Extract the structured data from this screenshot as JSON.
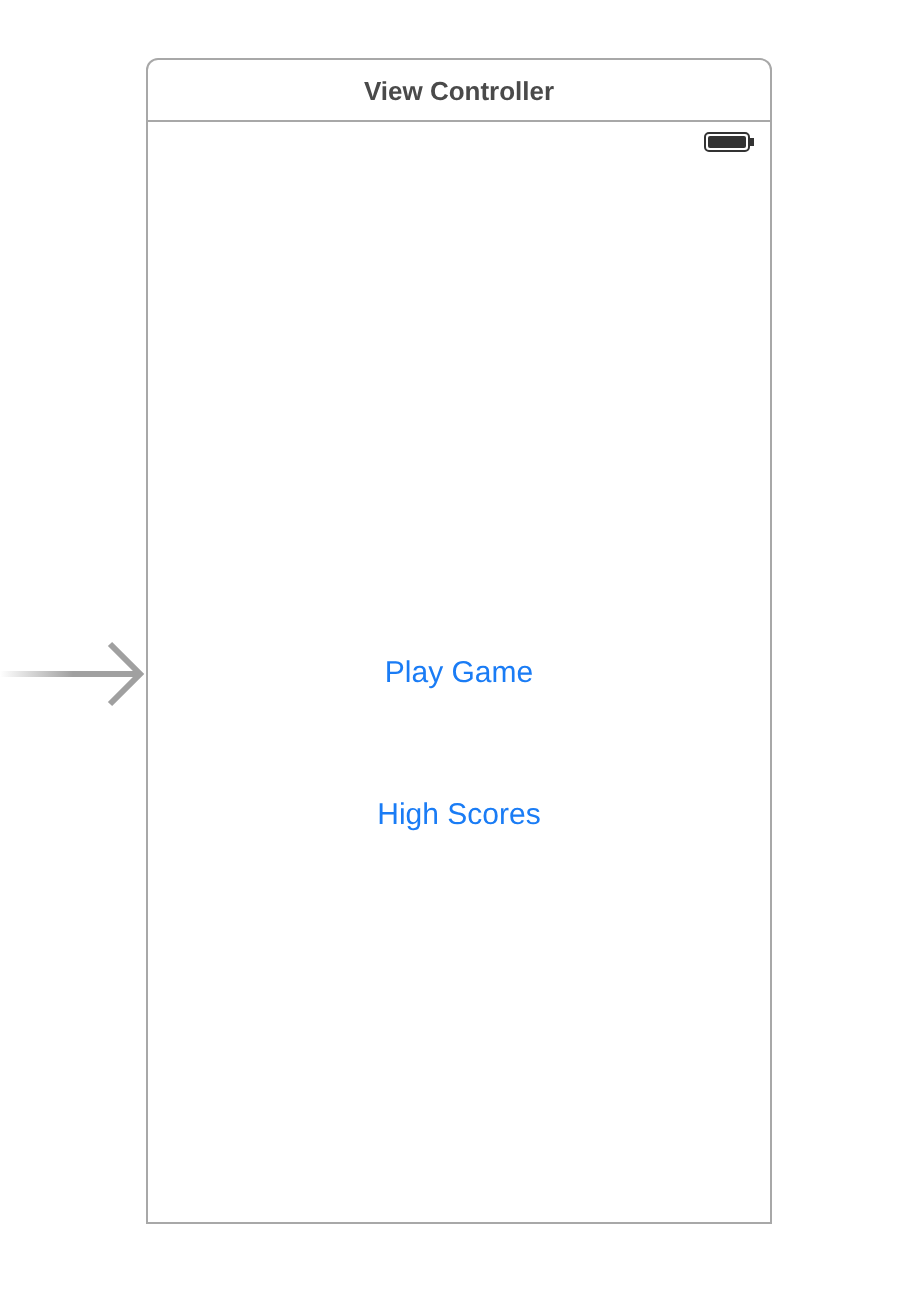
{
  "scene": {
    "title": "View Controller",
    "buttons": [
      {
        "label": "Play Game"
      },
      {
        "label": "High Scores"
      }
    ]
  }
}
